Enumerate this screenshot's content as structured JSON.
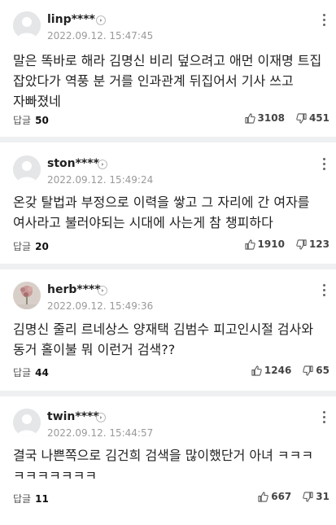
{
  "comments": [
    {
      "nickname": "linp****",
      "time": "2022.09.12. 15:47:45",
      "text": "말은 똑바로 해라 김명신 비리 덮으려고 애먼 이재명 트집 잡았다가 역풍 분 거를 인과관계 뒤집어서 기사 쓰고 자빠졌네",
      "reply_label": "답글",
      "reply_count": "50",
      "likes": "3108",
      "dislikes": "451"
    },
    {
      "nickname": "ston****",
      "time": "2022.09.12. 15:49:24",
      "text": "온갖 탈법과 부정으로 이력을 쌓고 그 자리에 간 여자를 여사라고 불러야되는 시대에 사는게 참 챙피하다",
      "reply_label": "답글",
      "reply_count": "20",
      "likes": "1910",
      "dislikes": "123"
    },
    {
      "nickname": "herb****",
      "time": "2022.09.12. 15:49:36",
      "text": "김명신 줄리 르네상스 양재택 김범수 피고인시절 검사와 동거 홀이불 뭐 이런거 검색??",
      "reply_label": "답글",
      "reply_count": "44",
      "likes": "1246",
      "dislikes": "65"
    },
    {
      "nickname": "twin****",
      "time": "2022.09.12. 15:44:57",
      "text": "결국 나쁜쪽으로 김건희 검색을 많이했단거 아녀 ㅋㅋㅋ ㅋㅋㅋㅋㅋㅋㅋ",
      "reply_label": "답글",
      "reply_count": "11",
      "likes": "667",
      "dislikes": "31"
    }
  ],
  "icons": {
    "profile": "default-avatar-icon",
    "profile_photo": "flower-photo-avatar",
    "arrow": "chevron-right-icon",
    "more": "more-vertical-icon",
    "like": "thumbs-up-icon",
    "dislike": "thumbs-down-icon"
  }
}
